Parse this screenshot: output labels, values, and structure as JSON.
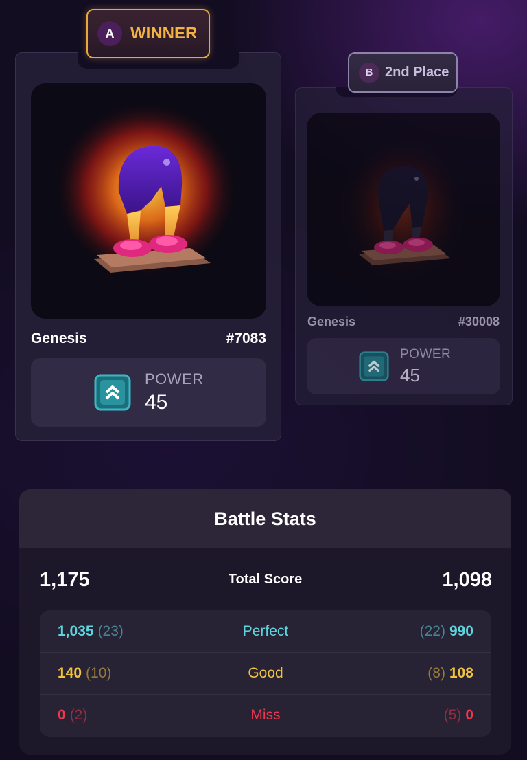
{
  "colors": {
    "winner_gold": "#f3b243",
    "perfect": "#5cd6de",
    "good": "#f2c23a",
    "miss": "#f0364a",
    "power_icon": "#3bb7c4"
  },
  "card_a": {
    "badge_letter": "A",
    "badge_label": "WINNER",
    "image": "purple-leggings-pink-sneakers-nft",
    "name": "Genesis",
    "number": "#7083",
    "power_label": "POWER",
    "power_value": "45",
    "power_icon": "double-chevron-up-icon"
  },
  "card_b": {
    "badge_letter": "B",
    "badge_label": "2nd Place",
    "image": "dark-leggings-pink-sneakers-nft",
    "name": "Genesis",
    "number": "#30008",
    "power_label": "POWER",
    "power_value": "45",
    "power_icon": "double-chevron-up-icon"
  },
  "battle_stats": {
    "title": "Battle Stats",
    "total": {
      "label": "Total Score",
      "a": "1,175",
      "b": "1,098"
    },
    "rows": [
      {
        "label": "Perfect",
        "a_value": "1,035",
        "a_count": "(23)",
        "b_count": "(22)",
        "b_value": "990",
        "color": "perfect"
      },
      {
        "label": "Good",
        "a_value": "140",
        "a_count": "(10)",
        "b_count": "(8)",
        "b_value": "108",
        "color": "good"
      },
      {
        "label": "Miss",
        "a_value": "0",
        "a_count": "(2)",
        "b_count": "(5)",
        "b_value": "0",
        "color": "miss"
      }
    ]
  }
}
